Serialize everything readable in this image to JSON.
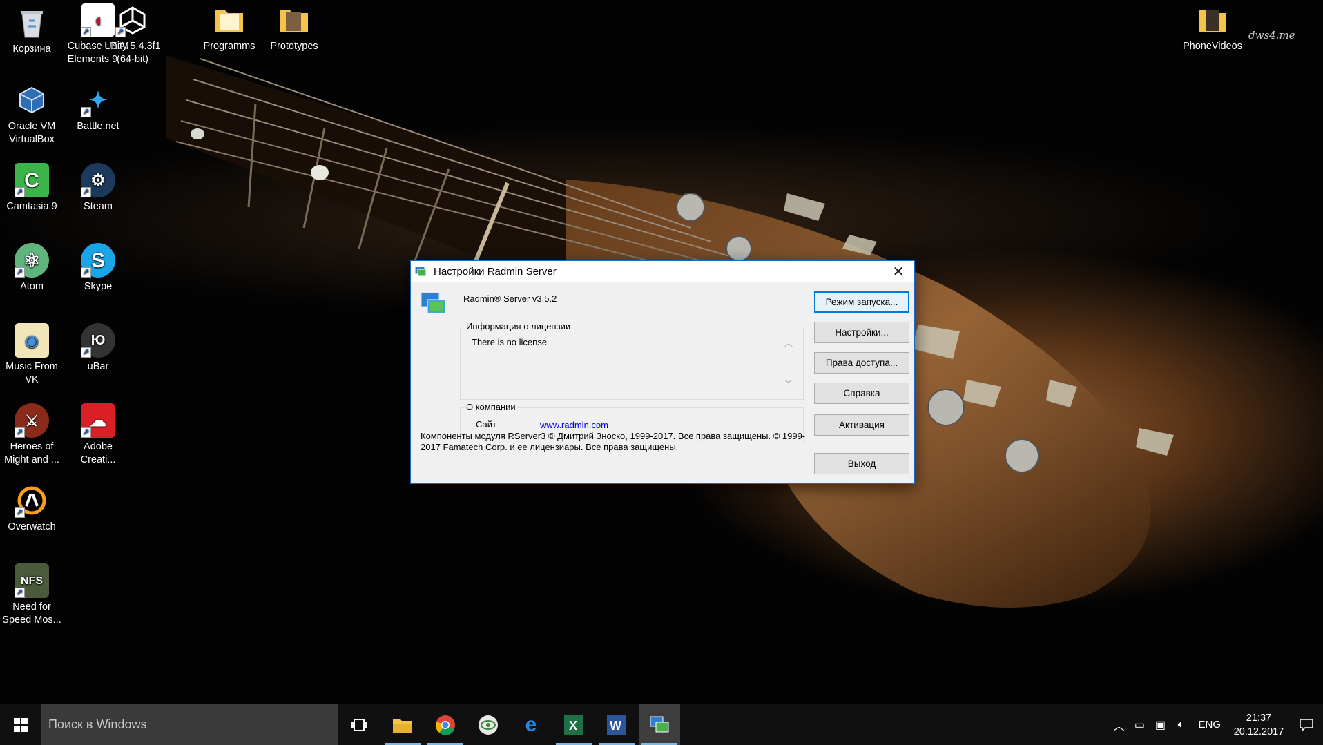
{
  "desktop": {
    "icons": [
      {
        "label": "Корзина"
      },
      {
        "label": "Cubase LE AI Elements 9 ..."
      },
      {
        "label": "Unity 5.4.3f1 (64-bit)"
      },
      {
        "label": "Programms"
      },
      {
        "label": "Prototypes"
      },
      {
        "label": "PhoneVideos"
      },
      {
        "label": "Oracle VM VirtualBox"
      },
      {
        "label": "Battle.net"
      },
      {
        "label": "Camtasia 9"
      },
      {
        "label": "Steam"
      },
      {
        "label": "Atom"
      },
      {
        "label": "Skype"
      },
      {
        "label": "Music From VK"
      },
      {
        "label": "uBar"
      },
      {
        "label": "Heroes of Might and ..."
      },
      {
        "label": "Adobe Creati..."
      },
      {
        "label": "Overwatch"
      },
      {
        "label": "Need for Speed Mos..."
      }
    ],
    "watermark": "dws4.me"
  },
  "dialog": {
    "title": "Настройки Radmin Server",
    "product": "Radmin® Server v3.5.2",
    "license_group": "Информация о лицензии",
    "license_text": "There is no license",
    "company_group": "О компании",
    "site_label": "Сайт",
    "site_link": "www.radmin.com",
    "copyright": "Компоненты модуля RServer3 © Дмитрий Зноско, 1999-2017. Все права защищены. © 1999-2017 Famatech Corp. и ее лицензиары. Все права защищены.",
    "buttons": {
      "startup_mode": "Режим запуска...",
      "settings": "Настройки...",
      "access_rights": "Права доступа...",
      "help": "Справка",
      "activation": "Активация",
      "exit": "Выход"
    }
  },
  "taskbar": {
    "search_placeholder": "Поиск в Windows",
    "language": "ENG",
    "time": "21:37",
    "date": "20.12.2017"
  }
}
